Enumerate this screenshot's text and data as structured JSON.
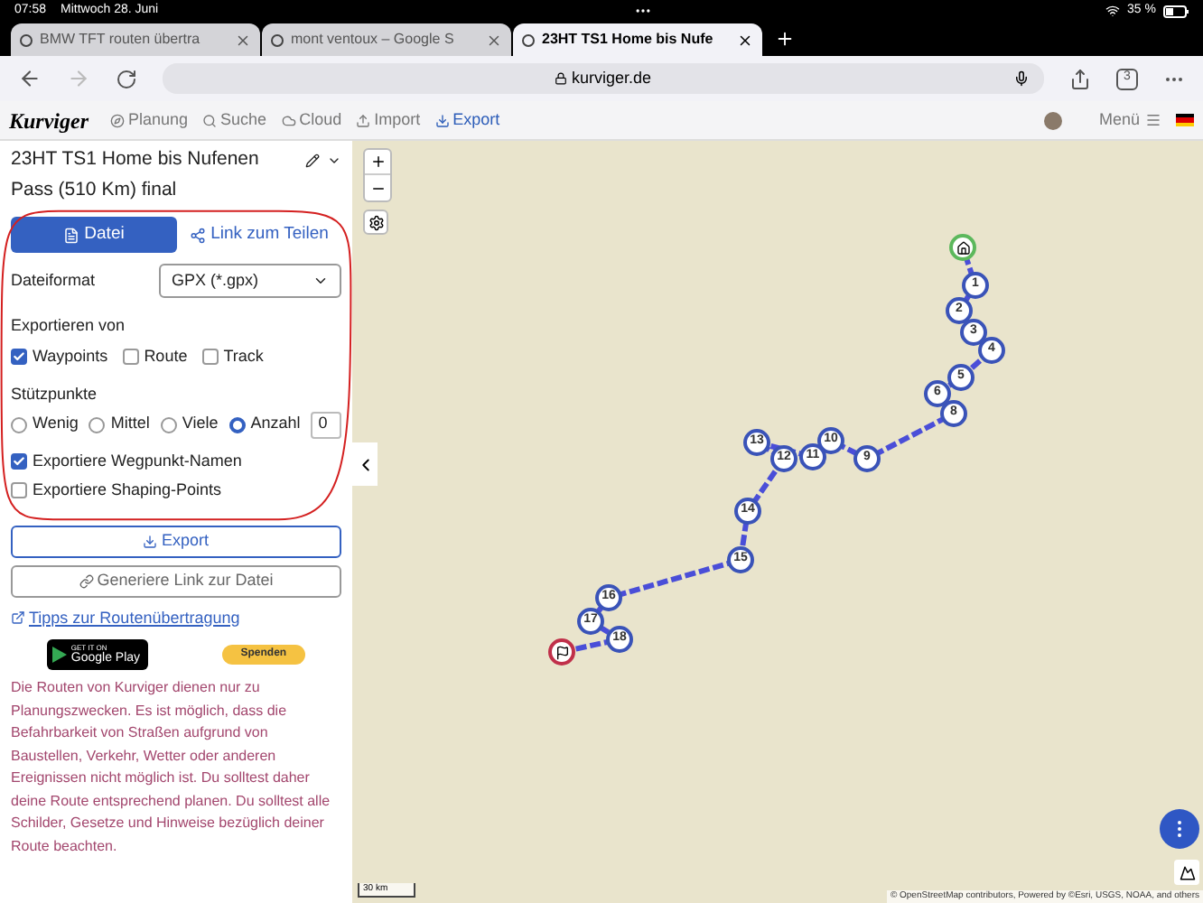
{
  "status_bar": {
    "time": "07:58",
    "date": "Mittwoch 28. Juni",
    "battery": "35 %"
  },
  "browser": {
    "tabs": [
      {
        "title": "BMW TFT routen übertra",
        "selected": false
      },
      {
        "title": "mont ventoux – Google S",
        "selected": false
      },
      {
        "title": "23HT TS1 Home bis Nufe",
        "selected": true
      }
    ],
    "address": "kurviger.de",
    "tab_count": "3"
  },
  "app_nav": {
    "logo": "Kurviger",
    "items": [
      {
        "label": "Planung",
        "selected": false
      },
      {
        "label": "Suche",
        "selected": false
      },
      {
        "label": "Cloud",
        "selected": false
      },
      {
        "label": "Import",
        "selected": false
      },
      {
        "label": "Export",
        "selected": true
      }
    ],
    "menu": "Menü"
  },
  "panel": {
    "title": "23HT TS1 Home bis Nufenen Pass (510 Km) final",
    "tabs": [
      {
        "label": "Datei",
        "selected": true
      },
      {
        "label": "Link zum Teilen",
        "selected": false
      }
    ],
    "file_format": {
      "label": "Dateiformat",
      "value": "GPX (*.gpx)"
    },
    "export_from": {
      "label": "Exportieren von",
      "options": [
        {
          "label": "Waypoints",
          "checked": true
        },
        {
          "label": "Route",
          "checked": false
        },
        {
          "label": "Track",
          "checked": false
        }
      ]
    },
    "support_points": {
      "label": "Stützpunkte",
      "options": [
        {
          "label": "Wenig",
          "selected": false
        },
        {
          "label": "Mittel",
          "selected": false
        },
        {
          "label": "Viele",
          "selected": false
        },
        {
          "label": "Anzahl",
          "selected": true
        }
      ],
      "count": "0"
    },
    "options": [
      {
        "label": "Exportiere Wegpunkt-Namen",
        "checked": true
      },
      {
        "label": "Exportiere Shaping-Points",
        "checked": false
      }
    ],
    "export_button": "Export",
    "generate_link_button": "Generiere Link zur Datei",
    "tips_link": "Tipps zur Routenübertragung",
    "google_play": {
      "small": "GET IT ON",
      "large": "Google Play"
    },
    "donate_button": "Spenden",
    "disclaimer": "Die Routen von Kurviger dienen nur zu Planungszwecken. Es ist möglich, dass die Befahrbarkeit von Straßen aufgrund von Baustellen, Verkehr, Wetter oder anderen Ereignissen nicht möglich ist. Du solltest daher deine Route entsprechend planen. Du solltest alle Schilder, Gesetze und Hinweise bezüglich deiner Route beachten."
  },
  "map": {
    "markers": [
      {
        "kind": "home"
      },
      {
        "kind": "waypoint",
        "label": "1"
      },
      {
        "kind": "waypoint",
        "label": "2"
      },
      {
        "kind": "waypoint",
        "label": "3"
      },
      {
        "kind": "waypoint",
        "label": "4"
      },
      {
        "kind": "waypoint",
        "label": "5"
      },
      {
        "kind": "waypoint",
        "label": "6"
      },
      {
        "kind": "waypoint",
        "label": "8"
      },
      {
        "kind": "waypoint",
        "label": "9"
      },
      {
        "kind": "waypoint",
        "label": "10"
      },
      {
        "kind": "waypoint",
        "label": "11"
      },
      {
        "kind": "waypoint",
        "label": "13"
      },
      {
        "kind": "waypoint",
        "label": "12"
      },
      {
        "kind": "waypoint",
        "label": "14"
      },
      {
        "kind": "waypoint",
        "label": "15"
      },
      {
        "kind": "waypoint",
        "label": "16"
      },
      {
        "kind": "waypoint",
        "label": "17"
      },
      {
        "kind": "waypoint",
        "label": "18"
      },
      {
        "kind": "finish"
      }
    ],
    "scale": "30 km",
    "attribution": "© OpenStreetMap contributors, Powered by ©Esri, USGS, NOAA, and others"
  }
}
